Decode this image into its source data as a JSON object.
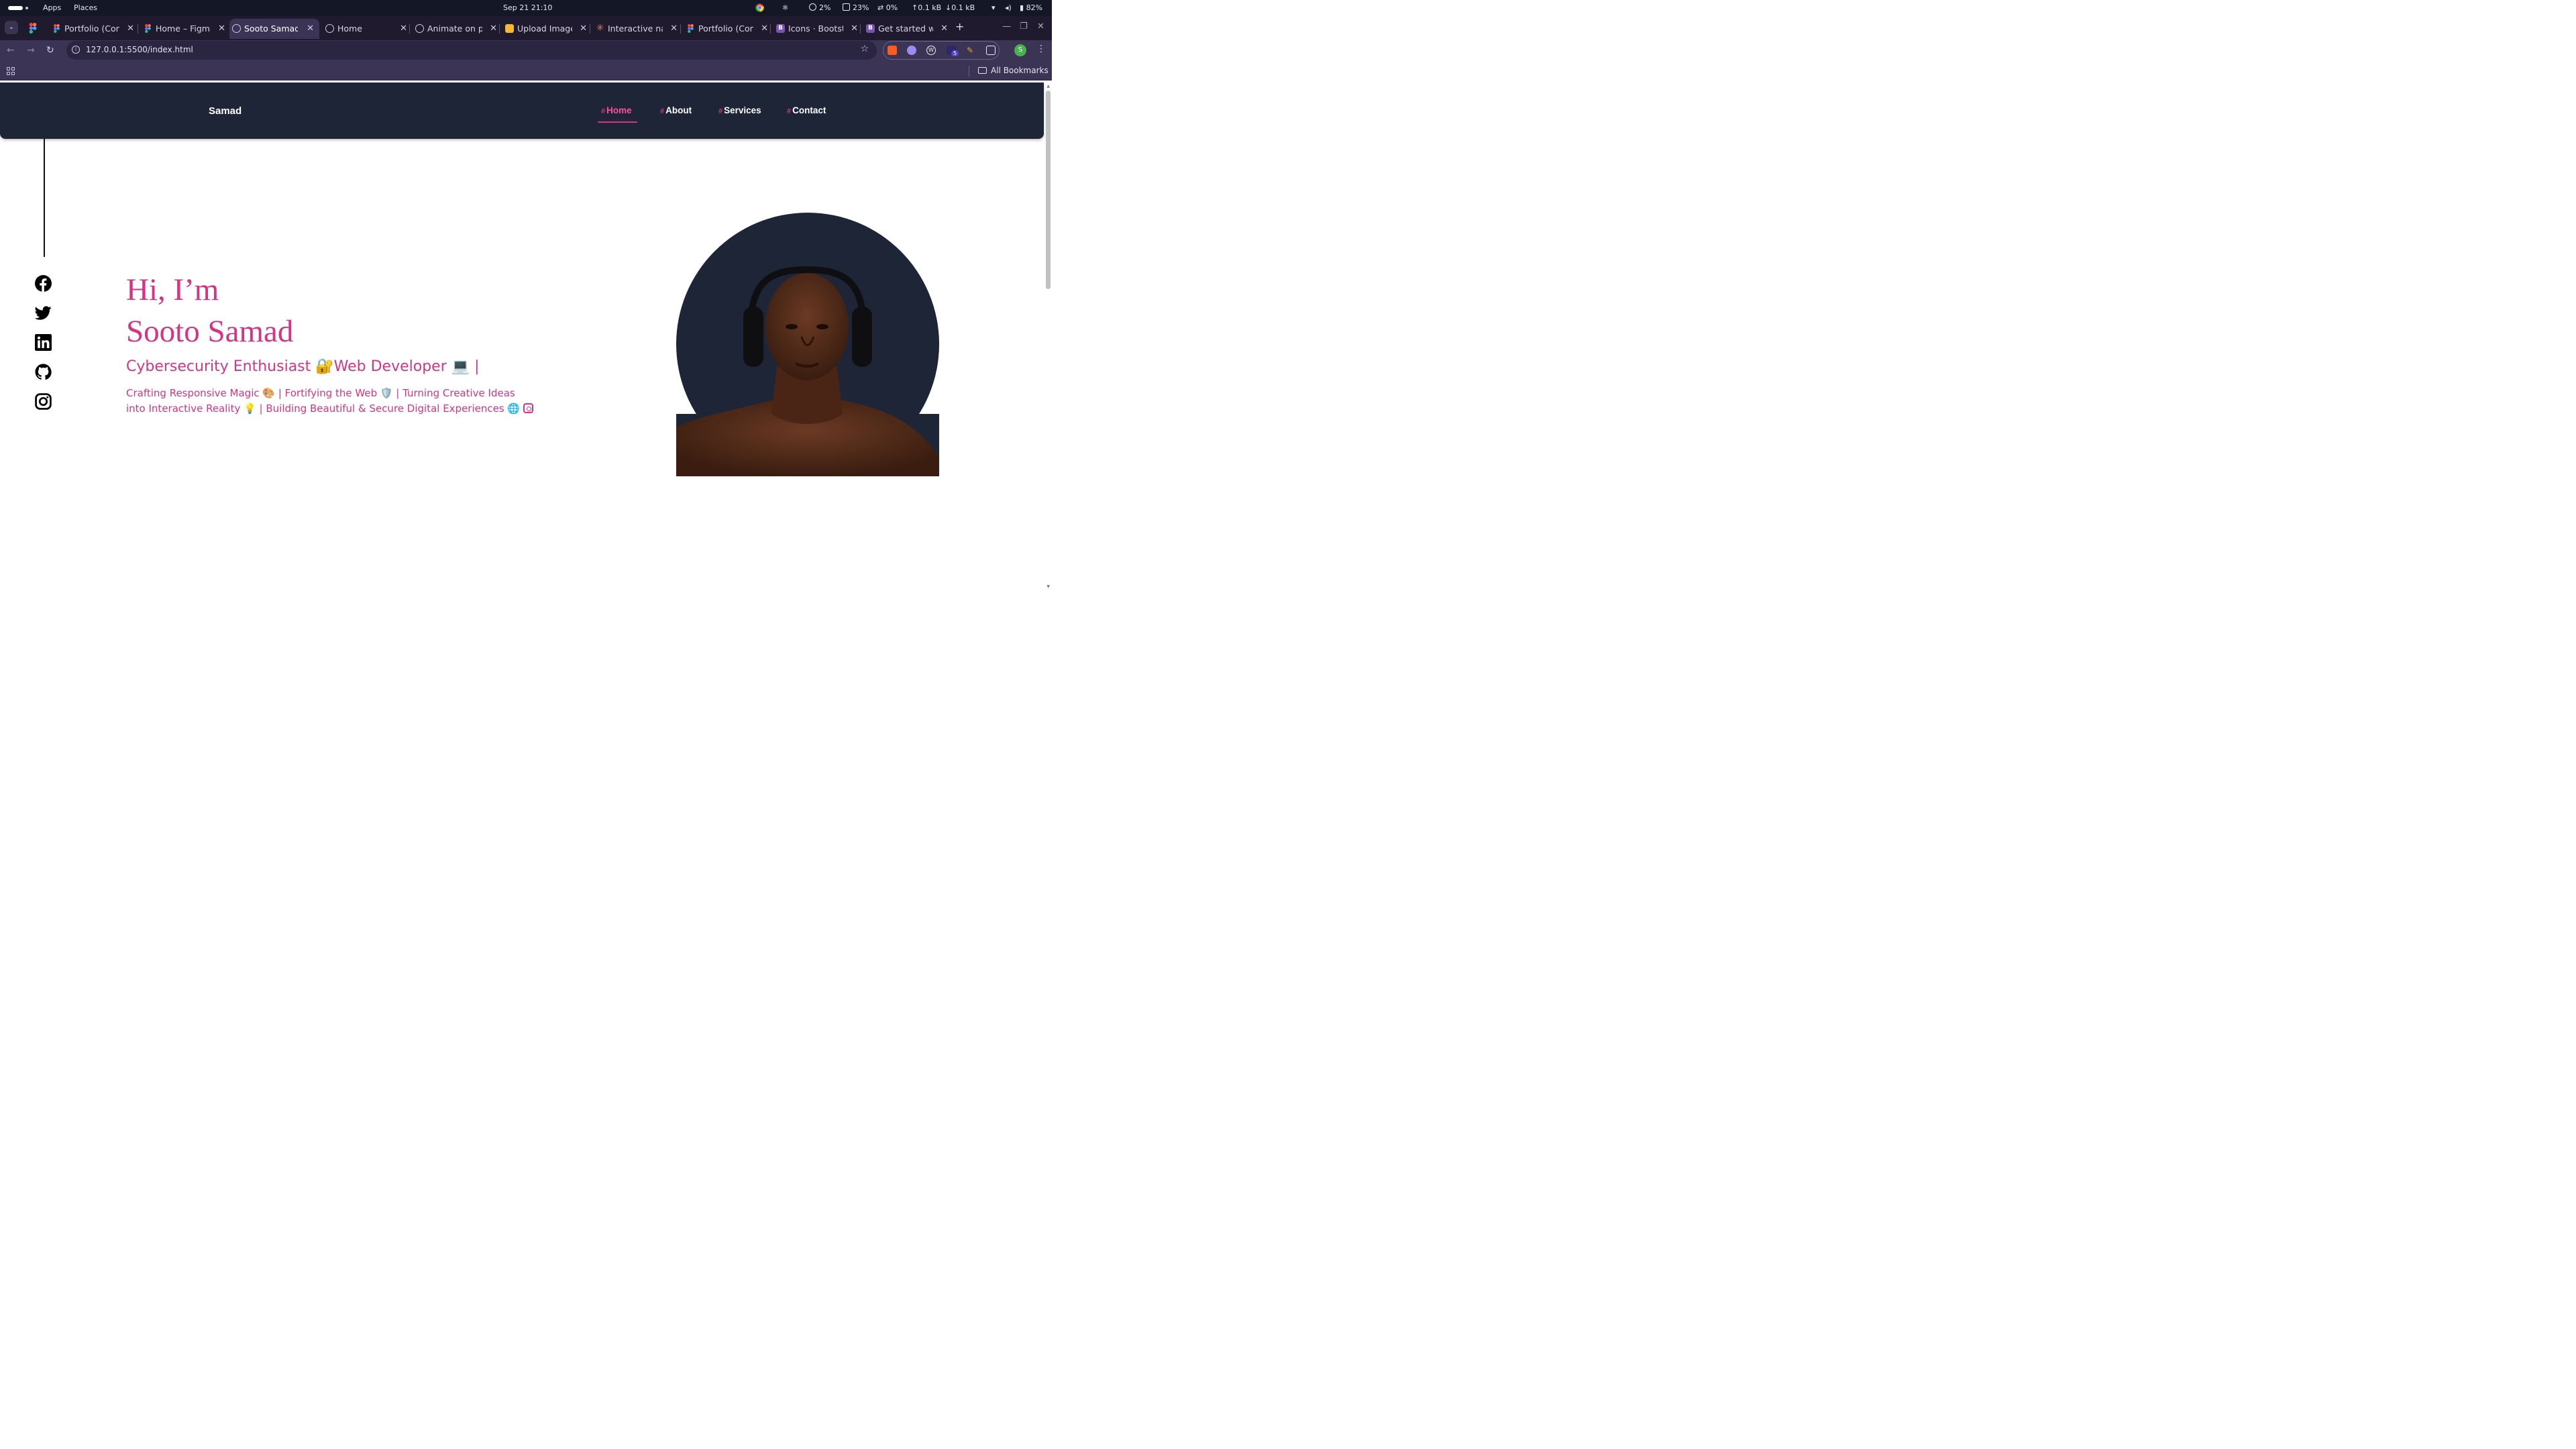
{
  "os": {
    "apps_label": "Apps",
    "places_label": "Places",
    "datetime": "Sep 21  21:10",
    "cpu": "2%",
    "mem": "23%",
    "swap": "0%",
    "up": "↑0.1 kB",
    "down": "↓0.1 kB",
    "battery": "82%"
  },
  "tabs": [
    {
      "title": "Portfolio (Con",
      "favicon": "figma-icon"
    },
    {
      "title": "Home – Figma",
      "favicon": "figma-icon"
    },
    {
      "title": "Sooto Samad",
      "favicon": "globe-icon",
      "active": true
    },
    {
      "title": "Home",
      "favicon": "globe-icon"
    },
    {
      "title": "Animate on p",
      "favicon": "openai-icon"
    },
    {
      "title": "Upload Image",
      "favicon": "imgbb-icon"
    },
    {
      "title": "Interactive na",
      "favicon": "claude-icon"
    },
    {
      "title": "Portfolio (Con",
      "favicon": "figma-icon"
    },
    {
      "title": "Icons · Bootstr",
      "favicon": "bootstrap-icon"
    },
    {
      "title": "Get started w",
      "favicon": "bootstrap-icon"
    }
  ],
  "address_bar": {
    "url": "127.0.0.1:5500/index.html",
    "profile_initial": "S",
    "extension_badge": "5"
  },
  "bookmarks": {
    "all_bookmarks_label": "All Bookmarks"
  },
  "site": {
    "brand": "Samad",
    "nav": [
      {
        "label": "Home",
        "active": true
      },
      {
        "label": "About"
      },
      {
        "label": "Services"
      },
      {
        "label": "Contact"
      }
    ],
    "nav_hash": "#",
    "hero": {
      "greeting": "Hi, I’m",
      "name": "Sooto Samad",
      "role": "Cybersecurity Enthusiast 🔐Web Developer 💻 |",
      "description": "Crafting Responsive Magic 🎨 | Fortifying the Web 🛡️ | Turning Creative Ideas into Interactive Reality 💡 | Building Beautiful & Secure Digital Experiences 🌐"
    },
    "socials": [
      "facebook-icon",
      "twitter-icon",
      "linkedin-icon",
      "github-icon",
      "instagram-icon"
    ],
    "colors": {
      "accent": "#d63384",
      "nav_bg": "#1e2536",
      "portrait_bg": "#1e2536"
    }
  }
}
